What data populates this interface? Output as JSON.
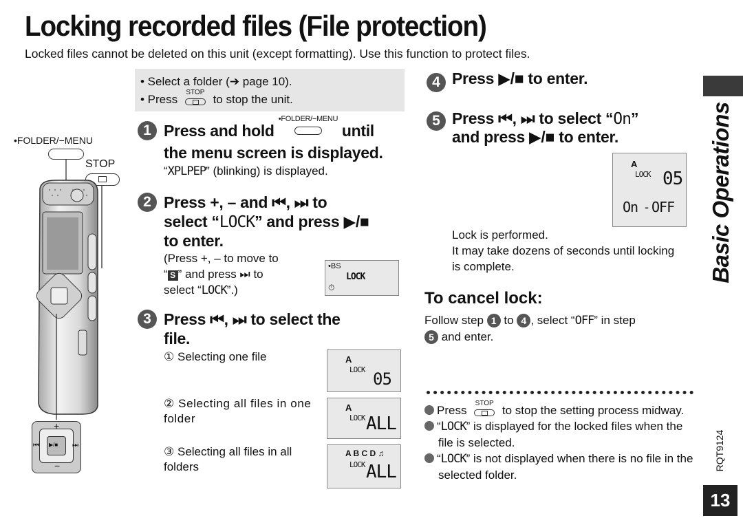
{
  "header": {
    "title": "Locking recorded files (File protection)",
    "subtitle": "Locked files cannot be deleted on this unit (except formatting). Use this function to protect files."
  },
  "prestep": {
    "line1_prefix": "• Select a folder (",
    "line1_arrow": "➔",
    "line1_suffix": " page 10).",
    "line2_prefix": "• Press ",
    "line2_suffix": " to stop the unit.",
    "stop_label": "STOP"
  },
  "device": {
    "folder_menu_label": "•FOLDER/−MENU",
    "stop_label": "STOP",
    "plus": "+",
    "minus": "−",
    "rew": "⏮",
    "ff": "⏭",
    "play": "▶/■"
  },
  "steps": [
    {
      "num": "1",
      "head_a": "Press and hold ",
      "key_label": "•FOLDER/−MENU",
      "head_b": " until",
      "head_c": "the menu screen is displayed.",
      "body_seg": "XPLPEP",
      "body_rest": " (blinking) is displayed."
    },
    {
      "num": "2",
      "head_a": "Press +, – and ⏮, ⏭ to",
      "head_b_prefix": "select “",
      "head_b_seg": "LOCK",
      "head_b_suffix": "” and press ▶/■",
      "head_c": "to enter.",
      "body1": "(Press +, – to move to",
      "body2_prefix": "“",
      "body2_icon": "S",
      "body2_suffix": "” and press ⏭ to",
      "body3_prefix": "select “",
      "body3_seg": "LOCK",
      "body3_suffix": "”.)",
      "lcd": {
        "top": "•BS",
        "main": "LOCK",
        "bottom": "⏱"
      }
    },
    {
      "num": "3",
      "head_a": "Press ⏮, ⏭ to select the",
      "head_b": "file.",
      "options": [
        {
          "marker": "①",
          "text": "Selecting one file",
          "lcd_folder": "A",
          "lcd_lock": "LOCK",
          "lcd_value": "05"
        },
        {
          "marker": "②",
          "text": "Selecting all files in one folder",
          "lcd_folder": "A",
          "lcd_lock": "LOCK",
          "lcd_value": "ALL"
        },
        {
          "marker": "③",
          "text": "Selecting all files in all folders",
          "lcd_folder": "A B C D ♫",
          "lcd_lock": "LOCK",
          "lcd_value": "ALL"
        }
      ]
    },
    {
      "num": "4",
      "head": "Press ▶/■ to enter."
    },
    {
      "num": "5",
      "head_a_prefix": "Press ⏮, ⏭ to select “",
      "head_a_seg": "On",
      "head_a_suffix": "”",
      "head_b": "and press ▶/■ to enter.",
      "lcd": {
        "folder": "A",
        "lock": "LOCK",
        "value": "05",
        "on": "On",
        "off": "OFF"
      },
      "result1": "Lock is performed.",
      "result2": "It may take dozens of seconds until locking is complete."
    }
  ],
  "cancel": {
    "heading": "To cancel lock:",
    "text_a": "Follow step ",
    "step_a": "1",
    "text_b": " to ",
    "step_b": "4",
    "text_c": ", select “",
    "seg": "OFF",
    "text_d": "” in step",
    "step_c": "5",
    "text_e": " and enter."
  },
  "notes": [
    {
      "prefix": "Press ",
      "key": "STOP",
      "suffix": " to stop the setting process midway."
    },
    {
      "prefix": "“",
      "seg": "LOCK",
      "suffix": "” is displayed for the locked files when the file is selected."
    },
    {
      "prefix": "“",
      "seg": "LOCK",
      "suffix": "” is not displayed when there is no file in the selected folder."
    }
  ],
  "side": {
    "section": "Basic Operations",
    "doc_code": "RQT9124",
    "page": "13"
  }
}
